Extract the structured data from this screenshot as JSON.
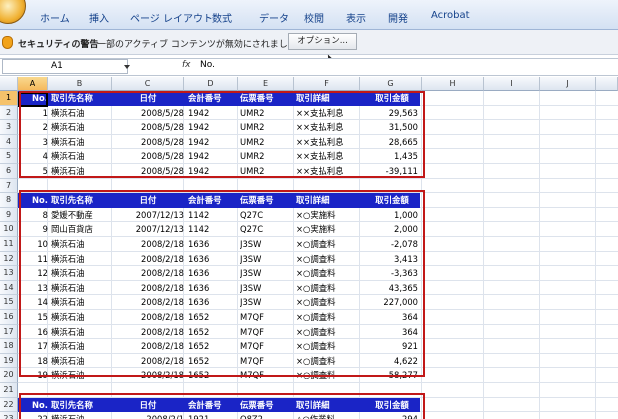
{
  "ribbon": {
    "tabs": [
      "ホーム",
      "挿入",
      "ページ レイアウト",
      "数式",
      "データ",
      "校閲",
      "表示",
      "開発",
      "Acrobat"
    ]
  },
  "security_bar": {
    "title": "セキュリティの警告",
    "message": "一部のアクティブ コンテンツが無効にされました。",
    "options_button": "オプション..."
  },
  "formula_bar": {
    "cell_ref": "A1",
    "fx_label": "fx",
    "value": "No."
  },
  "sheet": {
    "columns": [
      "A",
      "B",
      "C",
      "D",
      "E",
      "F",
      "G",
      "H",
      "I",
      "J"
    ],
    "row_numbers": [
      "1",
      "2",
      "3",
      "4",
      "5",
      "6",
      "7",
      "8",
      "9",
      "10",
      "11",
      "12",
      "13",
      "14",
      "15",
      "16",
      "17",
      "18",
      "19",
      "20",
      "21",
      "22",
      "23"
    ],
    "table_header": [
      "No.",
      "取引先名称",
      "日付",
      "会計番号",
      "伝票番号",
      "取引詳細",
      "取引金額"
    ],
    "table1": [
      [
        "1",
        "横浜石油",
        "2008/5/28",
        "1942",
        "UMR2",
        "××支払利息",
        "29,563"
      ],
      [
        "2",
        "横浜石油",
        "2008/5/28",
        "1942",
        "UMR2",
        "××支払利息",
        "31,500"
      ],
      [
        "3",
        "横浜石油",
        "2008/5/28",
        "1942",
        "UMR2",
        "××支払利息",
        "28,665"
      ],
      [
        "4",
        "横浜石油",
        "2008/5/28",
        "1942",
        "UMR2",
        "××支払利息",
        "1,435"
      ],
      [
        "5",
        "横浜石油",
        "2008/5/28",
        "1942",
        "UMR2",
        "××支払利息",
        "-39,111"
      ]
    ],
    "table2_header": [
      "No.",
      "取引先名称",
      "日付",
      "会計番号",
      "伝票番号",
      "取引詳細",
      "取引金額"
    ],
    "table2": [
      [
        "8",
        "愛媛不動産",
        "2007/12/13",
        "1142",
        "Q27C",
        "×○実施料",
        "1,000"
      ],
      [
        "9",
        "岡山百貨店",
        "2007/12/13",
        "1142",
        "Q27C",
        "×○実施料",
        "2,000"
      ],
      [
        "10",
        "横浜石油",
        "2008/2/18",
        "1636",
        "J3SW",
        "×○調査料",
        "-2,078"
      ],
      [
        "11",
        "横浜石油",
        "2008/2/18",
        "1636",
        "J3SW",
        "×○調査料",
        "3,413"
      ],
      [
        "12",
        "横浜石油",
        "2008/2/18",
        "1636",
        "J3SW",
        "×○調査料",
        "-3,363"
      ],
      [
        "13",
        "横浜石油",
        "2008/2/18",
        "1636",
        "J3SW",
        "×○調査料",
        "43,365"
      ],
      [
        "14",
        "横浜石油",
        "2008/2/18",
        "1636",
        "J3SW",
        "×○調査料",
        "227,000"
      ],
      [
        "15",
        "横浜石油",
        "2008/2/18",
        "1652",
        "M7QF",
        "×○調査料",
        "364"
      ],
      [
        "16",
        "横浜石油",
        "2008/2/18",
        "1652",
        "M7QF",
        "×○調査料",
        "364"
      ],
      [
        "17",
        "横浜石油",
        "2008/2/18",
        "1652",
        "M7QF",
        "×○調査料",
        "921"
      ],
      [
        "18",
        "横浜石油",
        "2008/2/18",
        "1652",
        "M7QF",
        "×○調査料",
        "4,622"
      ],
      [
        "19",
        "横浜石油",
        "2008/2/18",
        "1652",
        "M7QF",
        "×○調査料",
        "58,277"
      ]
    ],
    "table3_header": [
      "No.",
      "取引先名称",
      "日付",
      "会計番号",
      "伝票番号",
      "取引詳細",
      "取引金額"
    ],
    "table3": [
      [
        "22",
        "横浜石油",
        "2008/2/1",
        "1921",
        "Q8Z2",
        "△○作業料",
        "294"
      ]
    ]
  },
  "colors": {
    "table_header_bg": "#1a24c6",
    "highlight_border": "#c11818"
  }
}
